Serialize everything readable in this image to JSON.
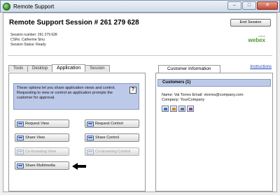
{
  "window": {
    "title": "Remote Support"
  },
  "session": {
    "heading": "Remote Support Session # 261 279 628",
    "end_button": "End Session",
    "number_line": "Session number: 261 279 628",
    "csrs_line": "CSRs: Catherine Sinu",
    "status_line": "Session Status: Ready"
  },
  "logo": {
    "small": "Cisco",
    "word": "webex"
  },
  "tabs": [
    "Tools",
    "Desktop",
    "Application",
    "Session"
  ],
  "active_tab": "Application",
  "application": {
    "info_text": "These options let you share application views and control.  Requesting to view or control an application prompts the customer for approval.",
    "help_label": "?",
    "buttons": {
      "request_view": "Request View",
      "request_control": "Request Control",
      "share_view": "Share View",
      "share_control": "Share Control",
      "cobrowsing_view": "Co-browsing View",
      "cobrowsing_control": "Co-browsing Control",
      "share_multimedia": "Share Multimedia"
    }
  },
  "right_panel": {
    "tab": "Customer Information",
    "instructions": "Instructions",
    "customers_header": "Customers (1)",
    "customer_line1": "Name: Val Torres Email: vtorres@company.com",
    "customer_line2": "Company: YourCompany",
    "action_icons": [
      "customer-profile-icon",
      "add-customer-icon",
      "transfer-icon",
      "remove-customer-icon"
    ]
  },
  "colors": {
    "info_bg": "#bcc9e8",
    "link": "#1a3fb0",
    "webex_green": "#4a9a2a"
  }
}
